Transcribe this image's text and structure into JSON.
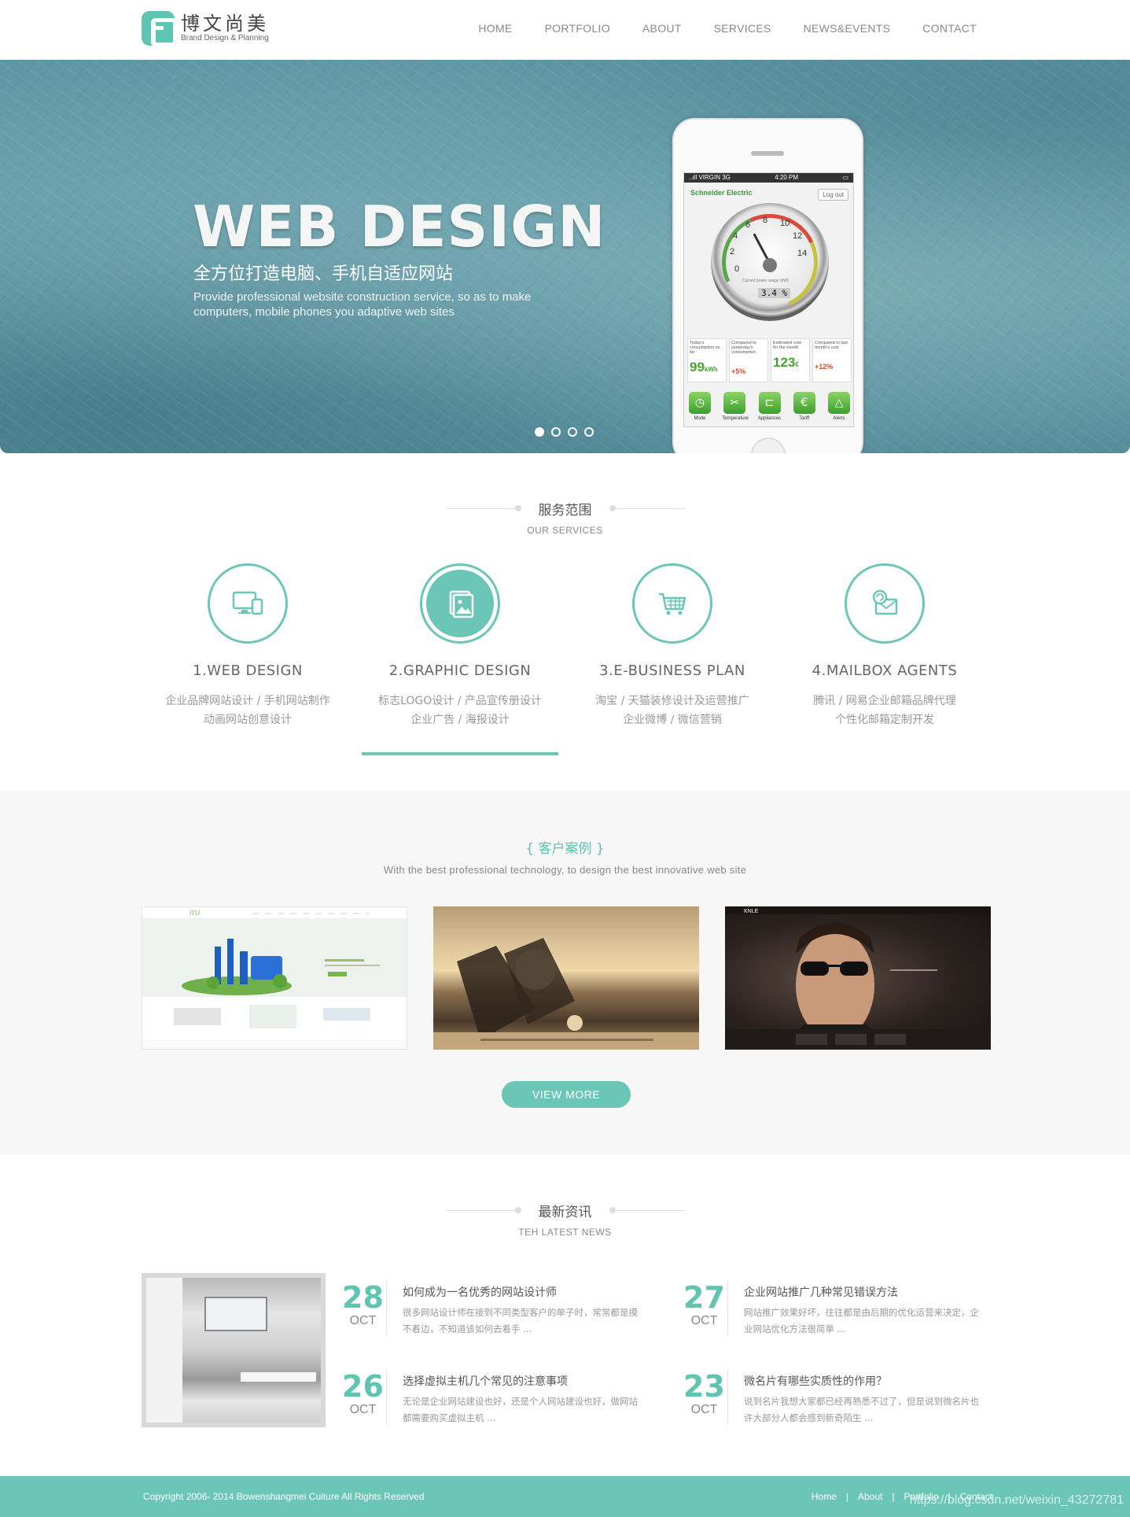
{
  "header": {
    "logo_cn": "博文尚美",
    "logo_en": "Brand Design & Planning",
    "nav": [
      "HOME",
      "PORTFOLIO",
      "ABOUT",
      "SERVICES",
      "NEWS&EVENTS",
      "CONTACT"
    ]
  },
  "hero": {
    "title": "WEB DESIGN",
    "subtitle_cn": "全方位打造电脑、手机自适应网站",
    "subtitle_en": "Provide professional website construction service, so as to make computers, mobile phones you adaptive web sites",
    "slides": 4,
    "active_slide": 1,
    "phone": {
      "carrier": "..ıll VIRGIN  3G",
      "time": "4:20 PM",
      "brand": "Schneider Electric",
      "logout": "Log out",
      "gauge_labels": [
        "0",
        "2",
        "4",
        "6",
        "8",
        "10",
        "12",
        "14"
      ],
      "gauge_caption": "Current power usage (kW)",
      "gauge_reading": "3.4",
      "gauge_unit": "%",
      "stats": [
        {
          "label": "Today's consumption so far",
          "value": "99",
          "unit": "kWh"
        },
        {
          "label": "Compared to yesterday's consumption",
          "value": "+5%"
        },
        {
          "label": "Estimated cost for the month",
          "value": "123",
          "unit": "€"
        },
        {
          "label": "Compared to last month's cost",
          "value": "+12%"
        }
      ],
      "icons": [
        "Mode",
        "Temperature",
        "Appliances",
        "Tariff",
        "Alerts"
      ]
    }
  },
  "services": {
    "title_cn": "服务范围",
    "title_en": "OUR SERVICES",
    "items": [
      {
        "title": "1.WEB DESIGN",
        "desc1": "企业品牌网站设计 / 手机网站制作",
        "desc2": "动画网站创意设计",
        "icon": "monitor-icon"
      },
      {
        "title": "2.GRAPHIC DESIGN",
        "desc1": "标志LOGO设计 / 产品宣传册设计",
        "desc2": "企业广告 / 海报设计",
        "icon": "image-icon"
      },
      {
        "title": "3.E-BUSINESS PLAN",
        "desc1": "淘宝 / 天猫装修设计及运营推广",
        "desc2": "企业微博 / 微信营销",
        "icon": "cart-icon"
      },
      {
        "title": "4.MAILBOX AGENTS",
        "desc1": "腾讯 / 网易企业邮箱品牌代理",
        "desc2": "个性化邮箱定制开发",
        "icon": "mail-icon"
      }
    ],
    "active_index": 1
  },
  "cases": {
    "title": "{ 客户案例 }",
    "subtitle": "With the best professional technology, to design the best innovative web site",
    "button": "VIEW MORE"
  },
  "news": {
    "title_cn": "最新资讯",
    "title_en": "TEH LATEST NEWS",
    "items": [
      {
        "day": "28",
        "month": "OCT",
        "title": "如何成为一名优秀的网站设计师",
        "text": "很多网站设计师在接到不同类型客户的单子时，常常都是摸不着边，不知道该如何去着手 ..."
      },
      {
        "day": "27",
        "month": "OCT",
        "title": "企业网站推广几种常见错误方法",
        "text": "网站推广效果好坏，往往都是由后期的优化运营来决定，企业网站优化方法很简单 ..."
      },
      {
        "day": "26",
        "month": "OCT",
        "title": "选择虚拟主机几个常见的注意事项",
        "text": "无论是企业网站建设也好，还是个人网站建设也好，做网站都需要购买虚拟主机 ..."
      },
      {
        "day": "23",
        "month": "OCT",
        "title": "微名片有哪些实质性的作用？",
        "text": "说到名片我想大家都已经再熟悉不过了，但是说到微名片也许大部分人都会感到新奇陌生 ..."
      }
    ]
  },
  "footer": {
    "copyright": "Copyright 2006- 2014 Bowenshangmei Culture All Rights Reserved",
    "links": [
      "Home",
      "About",
      "Portfolio",
      "Contact"
    ],
    "watermark": "https://blog.csdn.net/weixin_43272781"
  },
  "colors": {
    "accent": "#6cc6b7",
    "text": "#555555",
    "muted": "#999999"
  }
}
